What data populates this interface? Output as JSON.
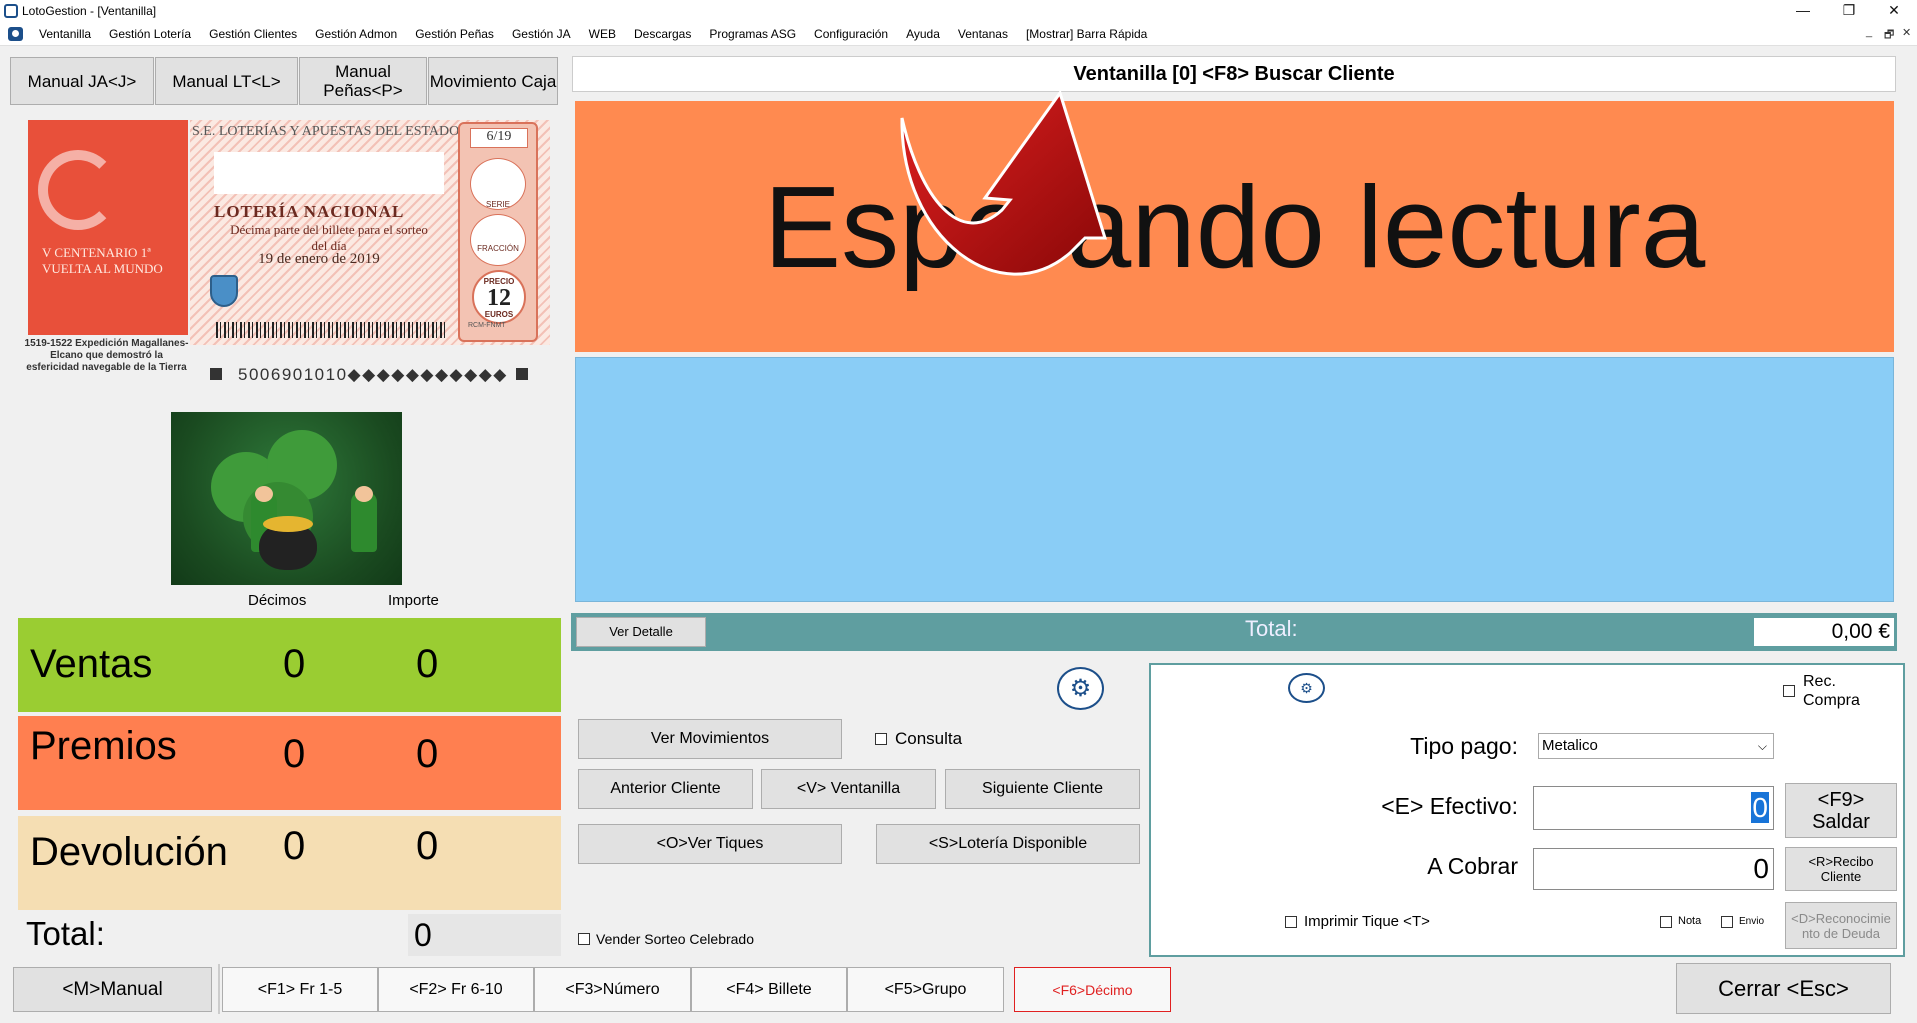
{
  "window": {
    "title": "LotoGestion - [Ventanilla]",
    "minimize": "—",
    "maximize": "❐",
    "close": "✕"
  },
  "menu": [
    "Ventanilla",
    "Gestión Lotería",
    "Gestión Clientes",
    "Gestión Admon",
    "Gestión Peñas",
    "Gestión JA",
    "WEB",
    "Descargas",
    "Programas ASG",
    "Configuración",
    "Ayuda",
    "Ventanas",
    "[Mostrar] Barra Rápida"
  ],
  "mdi": {
    "min": "_",
    "restore": "🗗",
    "close": "✕"
  },
  "left": {
    "buttons": [
      "Manual JA<J>",
      "Manual LT<L>",
      "Manual\nPeñas<P>",
      "Movimiento Caja"
    ],
    "ticket": {
      "header": "S.E. LOTERÍAS Y APUESTAS DEL ESTADO",
      "draw": "6/19",
      "title": "LOTERÍA NACIONAL",
      "subtitle": "Décima parte del billete para el sorteo del día",
      "date": "19 de enero de 2019",
      "serie": "SERIE",
      "fraccion": "FRACCIÓN",
      "price_label": "PRECIO",
      "price": "12",
      "price_unit": "EUROS",
      "photo_text": "V CENTENARIO 1ª VUELTA AL MUNDO",
      "caption": "1519-1522 Expedición Magallanes-Elcano que demostró la esfericidad navegable de la Tierra",
      "number": "5006901010◆◆◆◆◆◆◆◆◆◆◆",
      "mint": "RCM-FNMT"
    },
    "col_decimos": "Décimos",
    "col_importe": "Importe",
    "stats": [
      {
        "label": "Ventas",
        "decimos": "0",
        "importe": "0",
        "color": "#9acd32"
      },
      {
        "label": "Premios",
        "decimos": "0",
        "importe": "0",
        "color": "#ff7f50"
      },
      {
        "label": "Devolución",
        "decimos": "0",
        "importe": "0",
        "color": "#f5deb3"
      }
    ],
    "total_label": "Total:",
    "total_value": "0"
  },
  "right": {
    "header": "Ventanilla [0] <F8> Buscar Cliente",
    "status": "Esperando lectura",
    "ver_detalle": "Ver Detalle",
    "total_label": "Total:",
    "total_value": "0,00 €",
    "buttons": {
      "ver_movimientos": "Ver Movimientos",
      "consulta": "Consulta",
      "anterior": "Anterior Cliente",
      "ventanilla": "<V> Ventanilla",
      "siguiente": "Siguiente Cliente",
      "ver_tiques": "<O>Ver Tiques",
      "loteria_disponible": "<S>Lotería Disponible",
      "vender_sorteo": "Vender Sorteo Celebrado"
    },
    "payment": {
      "rec_compra": "Rec.\nCompra",
      "tipo_pago_label": "Tipo pago:",
      "tipo_pago_value": "Metalico",
      "efectivo_label": "<E> Efectivo:",
      "efectivo_value": "0",
      "a_cobrar_label": "A Cobrar",
      "a_cobrar_value": "0",
      "saldar": "<F9>\nSaldar",
      "recibo": "<R>Recibo\nCliente",
      "reconocimiento": "<D>Reconocimie\nnto de Deuda",
      "imprimir": "Imprimir Tique <T>",
      "nota": "Nota",
      "envio": "Envio"
    }
  },
  "bottom": {
    "manual": "<M>Manual",
    "fkeys": [
      "<F1> Fr 1-5",
      "<F2> Fr 6-10",
      "<F3>Número",
      "<F4> Billete",
      "<F5>Grupo",
      "<F6>Décimo"
    ],
    "close": "Cerrar <Esc>"
  },
  "colors": {
    "orange": "#ff8a50",
    "blue": "#8acdf6",
    "teal": "#5f9ea0",
    "f6_red": "#e02020"
  }
}
